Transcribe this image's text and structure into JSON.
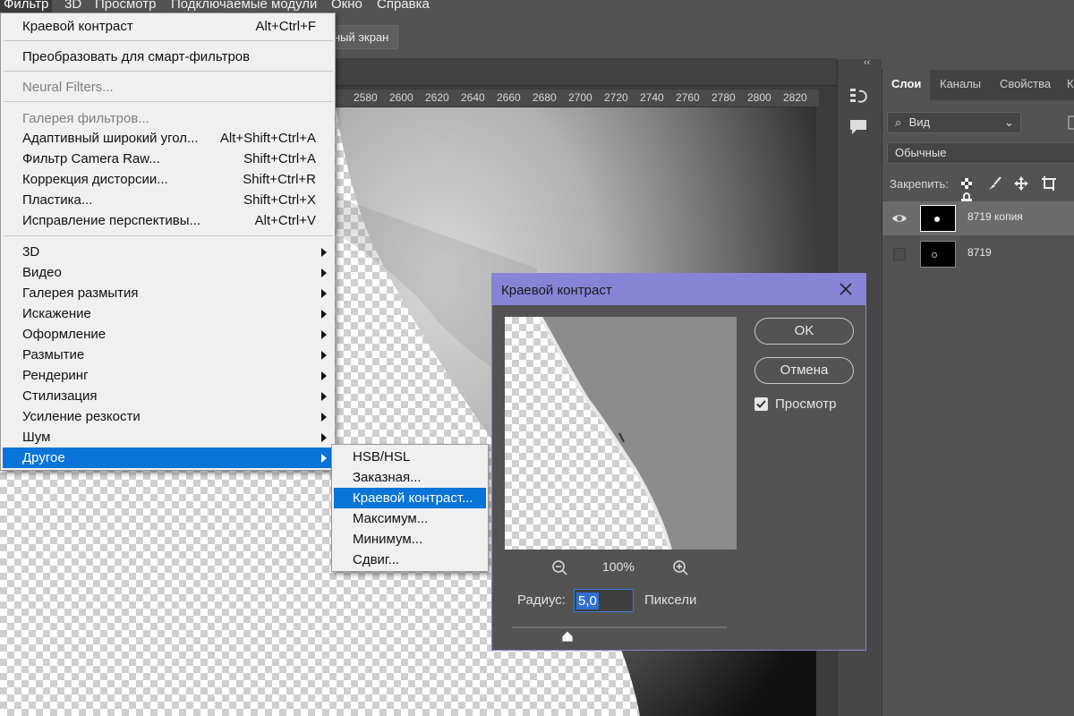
{
  "menubar": {
    "items": [
      "Фильтр",
      "3D",
      "Просмотр",
      "Подключаемые модули",
      "Окно",
      "Справка"
    ]
  },
  "options_bar": {
    "fullscreen_label": "ный экран"
  },
  "ruler": {
    "ticks": [
      "2580",
      "2600",
      "2620",
      "2640",
      "2660",
      "2680",
      "2700",
      "2720",
      "2740",
      "2760",
      "2780",
      "2800",
      "2820"
    ]
  },
  "filter_menu": {
    "last_filter": {
      "label": "Краевой контраст",
      "shortcut": "Alt+Ctrl+F"
    },
    "smart": {
      "label": "Преобразовать для смарт-фильтров"
    },
    "neural": {
      "label": "Neural Filters..."
    },
    "gallery": {
      "label": "Галерея фильтров..."
    },
    "adaptive": {
      "label": "Адаптивный широкий угол...",
      "shortcut": "Alt+Shift+Ctrl+A"
    },
    "camera_raw": {
      "label": "Фильтр Camera Raw...",
      "shortcut": "Shift+Ctrl+A"
    },
    "lens": {
      "label": "Коррекция дисторсии...",
      "shortcut": "Shift+Ctrl+R"
    },
    "liquify": {
      "label": "Пластика...",
      "shortcut": "Shift+Ctrl+X"
    },
    "vanishing": {
      "label": "Исправление перспективы...",
      "shortcut": "Alt+Ctrl+V"
    },
    "categories": [
      "3D",
      "Видео",
      "Галерея размытия",
      "Искажение",
      "Оформление",
      "Размытие",
      "Рендеринг",
      "Стилизация",
      "Усиление резкости",
      "Шум",
      "Другое"
    ]
  },
  "other_submenu": {
    "items": [
      "HSB/HSL",
      "Заказная...",
      "Краевой контраст...",
      "Максимум...",
      "Минимум...",
      "Сдвиг..."
    ]
  },
  "dialog": {
    "title": "Краевой контраст",
    "ok_label": "OK",
    "cancel_label": "Отмена",
    "preview_label": "Просмотр",
    "preview_checked": true,
    "zoom": "100%",
    "radius_label": "Радиус:",
    "radius_value": "5,0",
    "radius_unit": "Пиксели",
    "slider_fraction": 0.26
  },
  "panel": {
    "tabs": [
      "Слои",
      "Каналы",
      "Свойства",
      "К"
    ],
    "filter_kind": "Вид",
    "blend_mode": "Обычные",
    "lock_label": "Закрепить:",
    "layers": [
      {
        "name": "8719 копия",
        "visible": true,
        "selected": true
      },
      {
        "name": "8719",
        "visible": false,
        "selected": false
      }
    ]
  },
  "colors": {
    "dialog_title": "#8884d5",
    "menu_highlight": "#0a74d8"
  }
}
